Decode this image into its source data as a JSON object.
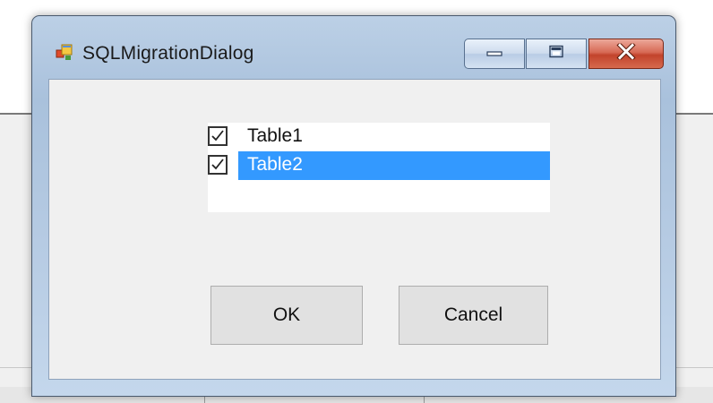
{
  "dialog": {
    "title": "SQLMigrationDialog",
    "icon": "windows-form-icon",
    "caption_buttons": [
      "minimize",
      "maximize",
      "close"
    ]
  },
  "table_list": {
    "items": [
      {
        "label": "Table1",
        "checked": true,
        "selected": false
      },
      {
        "label": "Table2",
        "checked": true,
        "selected": true
      }
    ]
  },
  "buttons": {
    "ok_label": "OK",
    "cancel_label": "Cancel"
  },
  "colors": {
    "selection": "#3399ff",
    "close_button": "#c2432c",
    "title_bar": "#a9c1dc"
  }
}
